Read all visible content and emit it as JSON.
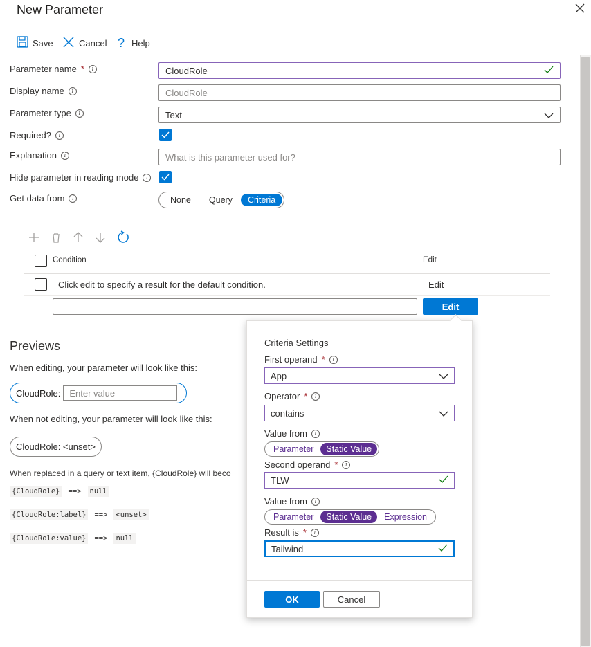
{
  "panel": {
    "title": "New Parameter"
  },
  "toolbar": {
    "save_label": "Save",
    "cancel_label": "Cancel",
    "help_label": "Help"
  },
  "form": {
    "parameter_name_label": "Parameter name",
    "parameter_name_value": "CloudRole",
    "display_name_label": "Display name",
    "display_name_placeholder": "CloudRole",
    "parameter_type_label": "Parameter type",
    "parameter_type_value": "Text",
    "required_label": "Required?",
    "explanation_label": "Explanation",
    "explanation_placeholder": "What is this parameter used for?",
    "hide_label": "Hide parameter in reading mode",
    "get_data_label": "Get data from",
    "get_data_options": [
      "None",
      "Query",
      "Criteria"
    ],
    "get_data_selected": "Criteria"
  },
  "criteria_table": {
    "col_condition": "Condition",
    "col_edit": "Edit",
    "row_text": "Click edit to specify a result for the default condition.",
    "row_edit": "Edit",
    "edit_button": "Edit"
  },
  "previews": {
    "heading": "Previews",
    "editing_text": "When editing, your parameter will look like this:",
    "edit_label": "CloudRole:",
    "edit_placeholder": "Enter value",
    "not_editing_text": "When not editing, your parameter will look like this:",
    "unset_chip": "CloudRole: <unset>",
    "replaced_text": "When replaced in a query or text item, {CloudRole} will beco",
    "lines": [
      {
        "token": "{CloudRole}",
        "arrow": "==>",
        "value": "null"
      },
      {
        "token": "{CloudRole:label}",
        "arrow": "==>",
        "value": "<unset>"
      },
      {
        "token": "{CloudRole:value}",
        "arrow": "==>",
        "value": "null"
      }
    ]
  },
  "criteria_dialog": {
    "title": "Criteria Settings",
    "first_operand_label": "First operand",
    "first_operand_value": "App",
    "operator_label": "Operator",
    "operator_value": "contains",
    "value_from_label": "Value from",
    "value_from_1": [
      "Parameter",
      "Static Value"
    ],
    "value_from_1_selected": "Static Value",
    "second_operand_label": "Second operand",
    "second_operand_value": "TLW",
    "value_from_label_2": "Value from",
    "value_from_2": [
      "Parameter",
      "Static Value",
      "Expression"
    ],
    "value_from_2_selected": "Static Value",
    "result_label": "Result is",
    "result_value": "Tailwind",
    "ok_label": "OK",
    "cancel_label": "Cancel"
  },
  "colors": {
    "accent": "#0078d4",
    "purple": "#5c2e91",
    "valid": "#107c10",
    "required": "#a4262c"
  }
}
